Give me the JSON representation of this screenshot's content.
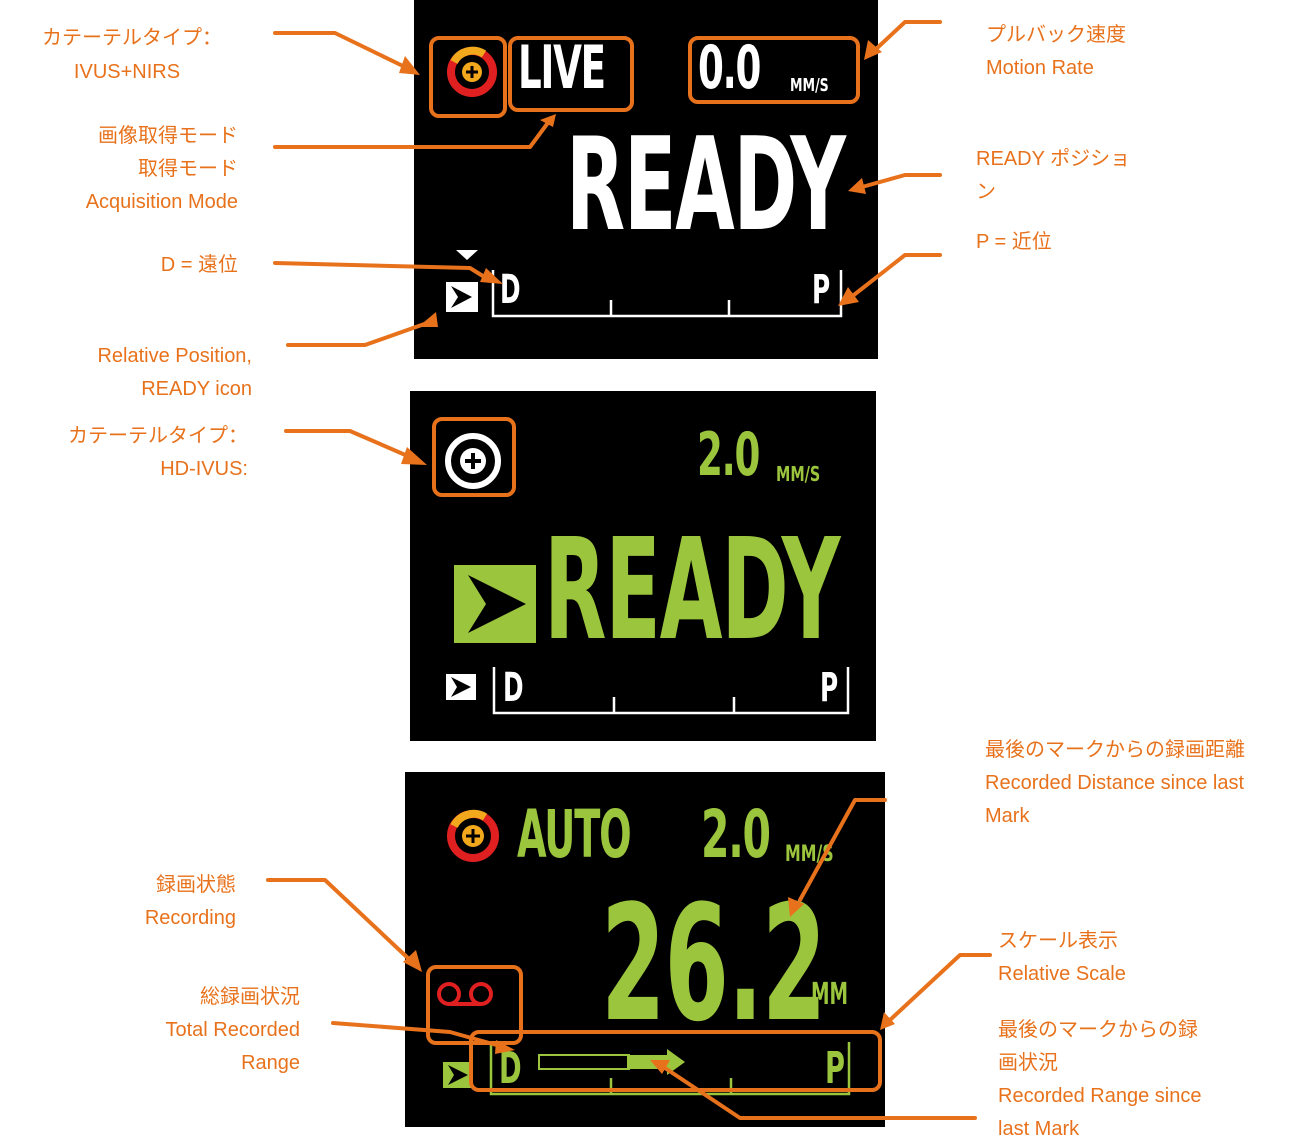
{
  "annotations": {
    "catheter_type_1": {
      "line1": "カテーテルタイプ：",
      "line2": "IVUS+NIRS"
    },
    "acquisition_mode": {
      "line1": "画像取得モード",
      "line2": "取得モード",
      "line3": "Acquisition Mode"
    },
    "distal": {
      "line1": "D =  遠位"
    },
    "relative_position": {
      "line1": "Relative Position,",
      "line2": "READY icon"
    },
    "catheter_type_2": {
      "line1": "カテーテルタイプ：",
      "line2": "HD-IVUS:"
    },
    "pullback_speed": {
      "line1": "プルバック速度",
      "line2": "Motion Rate"
    },
    "ready_position": {
      "line1": "READY ポジショ",
      "line2": "ン"
    },
    "proximal": {
      "line1": "P =  近位"
    },
    "recorded_distance": {
      "line1": "最後のマークからの録画距離",
      "line2": "Recorded Distance since last",
      "line3": "Mark"
    },
    "recording_state": {
      "line1": "録画状態",
      "line2": "Recording"
    },
    "relative_scale": {
      "line1": "スケール表示",
      "line2": "Relative Scale"
    },
    "total_recorded": {
      "line1": "総録画状況",
      "line2": "Total Recorded",
      "line3": "Range"
    },
    "range_since_mark": {
      "line1": "最後のマークからの録",
      "line2": "画状況",
      "line3": "Recorded Range since",
      "line4": "last Mark"
    }
  },
  "screen1": {
    "mode": "LIVE",
    "speed_value": "0.0",
    "speed_unit": "MM/S",
    "status": "READY",
    "scale_left": "D",
    "scale_right": "P"
  },
  "screen2": {
    "speed_value": "2.0",
    "speed_unit": "MM/S",
    "status": "READY",
    "scale_left": "D",
    "scale_right": "P"
  },
  "screen3": {
    "mode": "AUTO",
    "speed_value": "2.0",
    "speed_unit": "MM/S",
    "distance_value": "26.2",
    "distance_unit": "MM",
    "scale_left": "D",
    "scale_right": "P"
  },
  "colors": {
    "annotation": "#e8721c",
    "display_green": "#9bc53d",
    "display_white": "#ffffff",
    "recording_red": "#e02020",
    "screen_background": "#000000"
  },
  "icons": {
    "ivus_nirs_catheter": "catheter-ivus-nirs-icon",
    "hd_ivus_catheter": "catheter-hd-ivus-icon",
    "ready": "ready-arrow-icon",
    "recording": "recording-tape-icon"
  }
}
